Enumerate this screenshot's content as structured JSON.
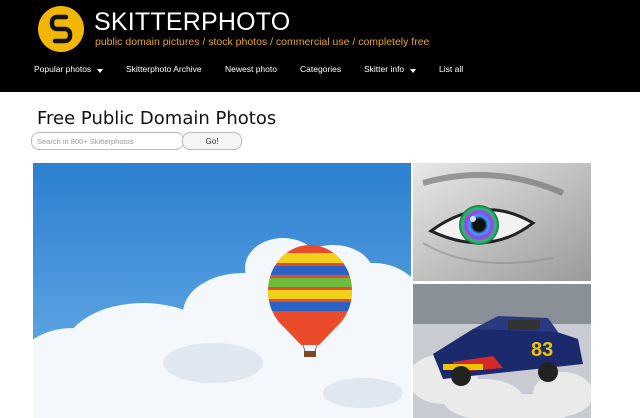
{
  "site": {
    "title": "SKITTERPHOTO",
    "tagline": "public domain pictures / stock photos / commercial use / completely free",
    "logo_icon": "s-logo-icon",
    "accent": "#f2b705"
  },
  "nav": {
    "items": [
      {
        "label": "Popular photos",
        "dropdown": true
      },
      {
        "label": "Skitterphoto Archive",
        "dropdown": false
      },
      {
        "label": "Newest photo",
        "dropdown": false
      },
      {
        "label": "Categories",
        "dropdown": false
      },
      {
        "label": "Skitter info",
        "dropdown": true
      },
      {
        "label": "List all",
        "dropdown": false
      }
    ]
  },
  "main": {
    "title": "Free Public Domain Photos",
    "search": {
      "placeholder": "Search in 800+ Skitterphotos",
      "value": ""
    },
    "go_label": "Go!"
  }
}
